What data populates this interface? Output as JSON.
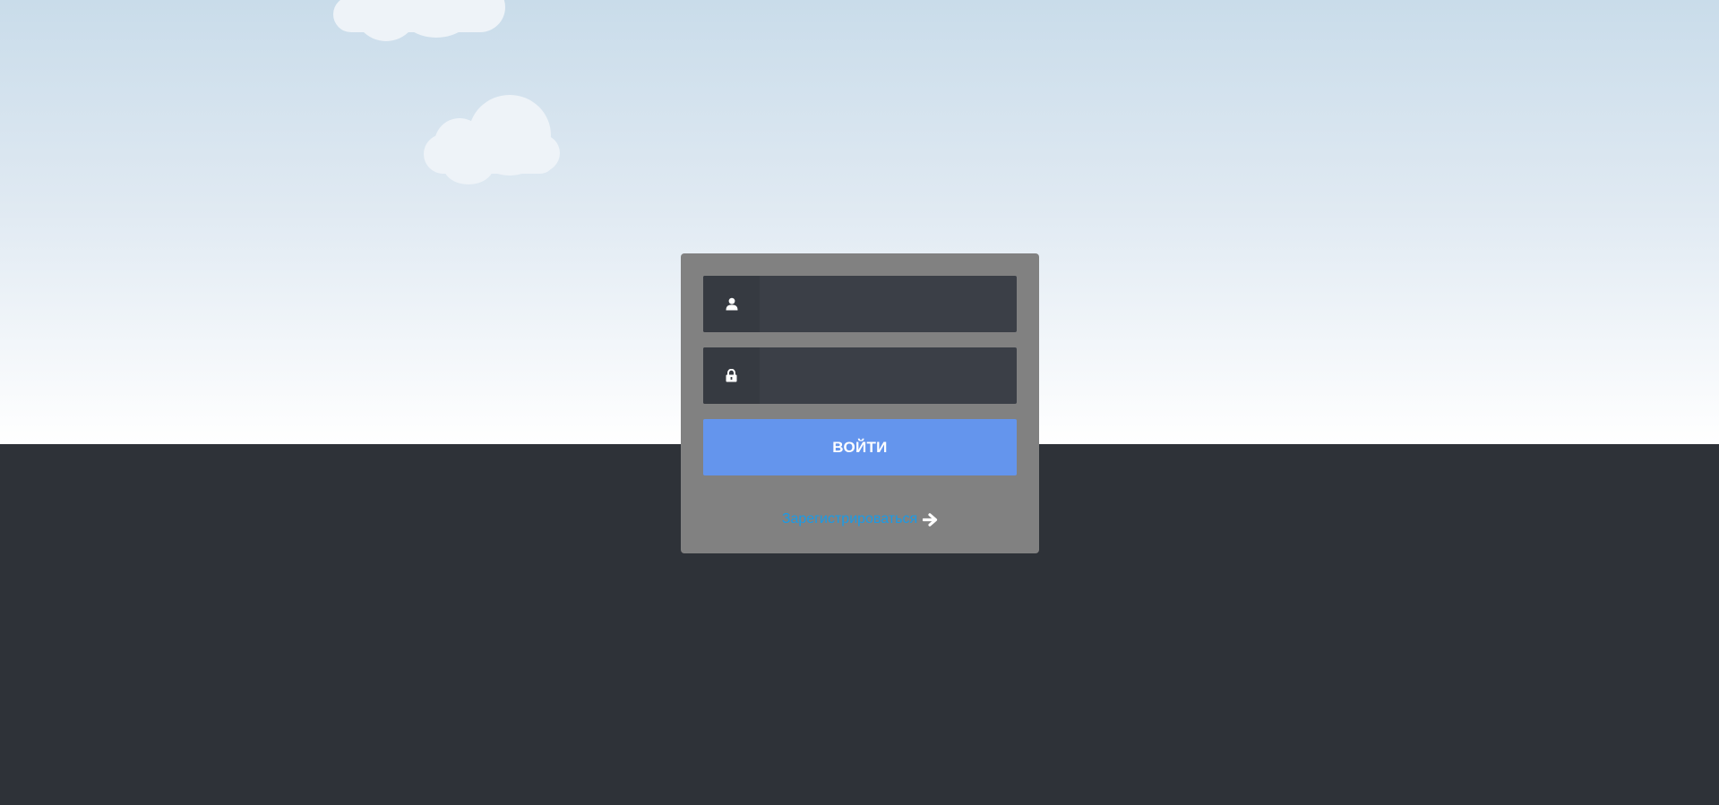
{
  "colors": {
    "sky_top": "#c9dcea",
    "sky_bottom": "#ffffff",
    "ground": "#2e3238",
    "card": "#818181",
    "field_bg": "#3b3f47",
    "button": "#6495ed",
    "link": "#1a9be6"
  },
  "login_form": {
    "username_field": {
      "icon": "user-icon",
      "value": "",
      "placeholder": ""
    },
    "password_field": {
      "icon": "lock-icon",
      "value": "",
      "placeholder": ""
    },
    "submit_label": "ВОЙТИ",
    "register_link": {
      "label": "Зарегистрироваться",
      "icon": "arrow-right-icon"
    }
  }
}
